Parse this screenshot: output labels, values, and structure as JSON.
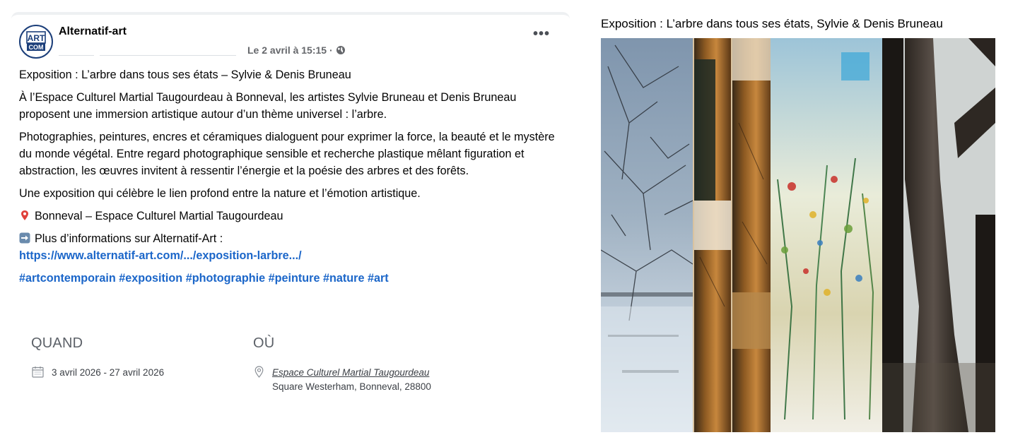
{
  "post": {
    "author": "Alternatif-art",
    "avatar_text_top": "ART",
    "avatar_text_bottom": "COM",
    "date": "Le 2 avril à 15:15 ·",
    "more_label": "•••",
    "title": "Exposition : L’arbre dans tous ses états – Sylvie & Denis Bruneau",
    "paragraph_1": "À l’Espace Culturel Martial Taugourdeau à Bonneval, les artistes Sylvie Bruneau et Denis Bruneau proposent une immersion artistique autour d’un thème universel : l’arbre.",
    "paragraph_2": "Photographies, peintures, encres et céramiques dialoguent pour exprimer la force, la beauté et le mystère du monde végétal. Entre regard photographique sensible et recherche plastique mêlant figuration et abstraction, les œuvres invitent à ressentir l’énergie et la poésie des arbres et des forêts.",
    "paragraph_3": "Une exposition qui célèbre le lien profond entre la nature et l’émotion artistique.",
    "location_line": "Bonneval – Espace Culturel Martial Taugourdeau",
    "info_line": "Plus d’informations sur Alternatif-Art :",
    "url": "https://www.alternatif-art.com/.../exposition-larbre.../",
    "hashtags": [
      "#artcontemporain",
      "#exposition",
      "#photographie",
      "#peinture",
      "#nature",
      "#art"
    ]
  },
  "event": {
    "when_heading": "QUAND",
    "when_value": "3 avril 2026 - 27 avril 2026",
    "where_heading": "OÙ",
    "venue": "Espace Culturel Martial Taugourdeau",
    "address": "Square Westerham, Bonneval, 28800"
  },
  "panel": {
    "title": "Exposition : L’arbre dans tous ses états, Sylvie & Denis Bruneau"
  },
  "colors": {
    "link": "#1b66c9",
    "text": "#050505",
    "muted": "#65676b"
  }
}
